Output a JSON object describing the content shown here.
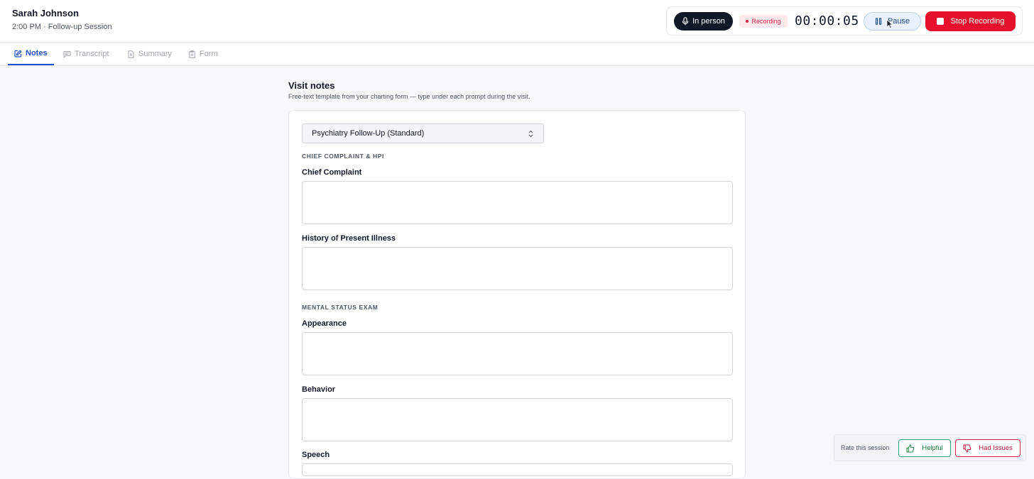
{
  "header": {
    "patient_name": "Sarah Johnson",
    "session_info": "2:00 PM · Follow-up Session"
  },
  "recording": {
    "mode_label": "In person",
    "status_label": "Recording",
    "timer": "00:00:05",
    "pause_label": "Pause",
    "stop_label": "Stop Recording"
  },
  "tabs": [
    {
      "label": "Notes",
      "icon": "edit-icon",
      "active": true
    },
    {
      "label": "Transcript",
      "icon": "message-icon",
      "active": false
    },
    {
      "label": "Summary",
      "icon": "document-icon",
      "active": false
    },
    {
      "label": "Form",
      "icon": "clipboard-icon",
      "active": false
    }
  ],
  "main": {
    "title": "Visit notes",
    "description": "Free-text template from your charting form — type under each prompt during the visit.",
    "template_selected": "Psychiatry Follow-Up (Standard)",
    "sections": [
      {
        "title": "CHIEF COMPLAINT & HPI",
        "fields": [
          "Chief Complaint",
          "History of Present Illness"
        ]
      },
      {
        "title": "MENTAL STATUS EXAM",
        "fields": [
          "Appearance",
          "Behavior",
          "Speech"
        ]
      }
    ]
  },
  "rating": {
    "label": "Rate this session",
    "helpful_label": "Helpful",
    "issues_label": "Had Issues"
  },
  "colors": {
    "accent": "#1d4ed8",
    "stop": "#e8112d",
    "recording": "#e11d48",
    "helpful": "#15803d"
  }
}
